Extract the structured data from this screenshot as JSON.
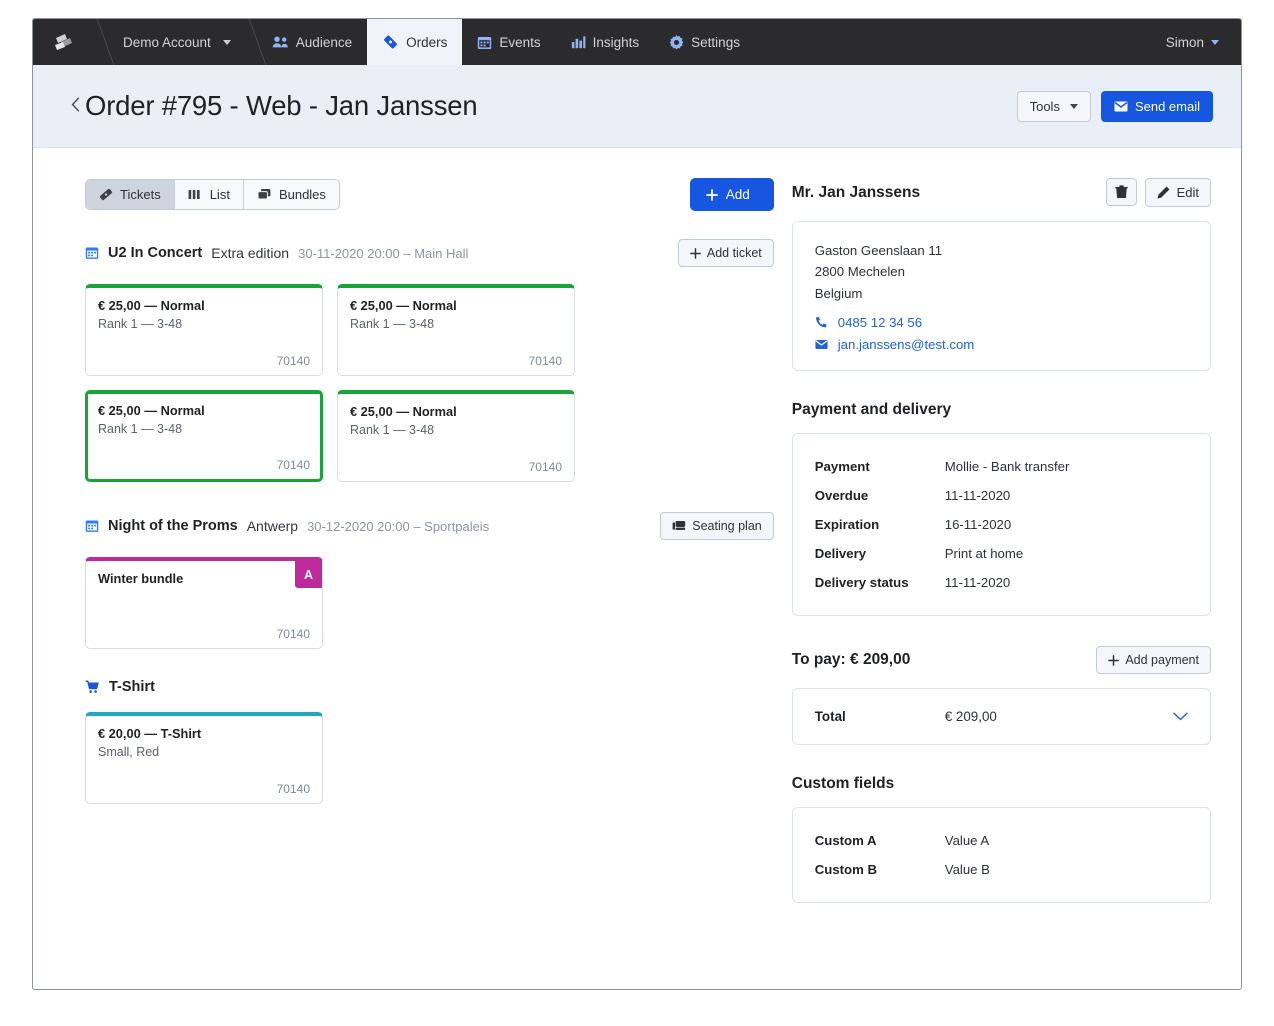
{
  "topnav": {
    "logo_icon": "ticketmatic-logo-icon",
    "account": {
      "label": "Demo Account",
      "icon": "caret-down-icon"
    },
    "items": [
      {
        "label": "Audience",
        "icon": "audience-people-icon",
        "active": false
      },
      {
        "label": "Orders",
        "icon": "ticket-diamond-icon",
        "active": true
      },
      {
        "label": "Events",
        "icon": "calendar-icon",
        "active": false
      },
      {
        "label": "Insights",
        "icon": "bar-chart-icon",
        "active": false
      },
      {
        "label": "Settings",
        "icon": "gear-icon",
        "active": false
      }
    ],
    "user": {
      "label": "Simon",
      "icon": "caret-down-icon"
    }
  },
  "header": {
    "back_icon": "chevron-left-icon",
    "title": "Order #795 - Web - Jan Janssen",
    "tools_label": "Tools",
    "send_email_label": "Send email",
    "send_email_icon": "envelope-icon"
  },
  "toolbar": {
    "tabs": [
      {
        "label": "Tickets",
        "icon": "ticket-icon",
        "active": true
      },
      {
        "label": "List",
        "icon": "list-bars-icon",
        "active": false
      },
      {
        "label": "Bundles",
        "icon": "bundles-stack-icon",
        "active": false
      }
    ],
    "add_label": "Add",
    "add_icon": "plus-icon",
    "add_caret": "caret-down-icon"
  },
  "groups": [
    {
      "icon": "calendar-icon",
      "title": "U2 In Concert",
      "subtitle": "Extra edition",
      "meta": "30-11-2020 20:00 – Main Hall",
      "action": {
        "label": "Add ticket",
        "icon": "plus-icon"
      },
      "cards": [
        {
          "title": "€ 25,00 — Normal",
          "sub": "Rank 1 — 3-48",
          "code": "70140",
          "accent": "#18a538",
          "selected": false
        },
        {
          "title": "€ 25,00 — Normal",
          "sub": "Rank 1 — 3-48",
          "code": "70140",
          "accent": "#18a538",
          "selected": false
        },
        {
          "title": "€ 25,00 — Normal",
          "sub": "Rank 1 — 3-48",
          "code": "70140",
          "accent": "#18a538",
          "selected": true
        },
        {
          "title": "€ 25,00 — Normal",
          "sub": "Rank 1 — 3-48",
          "code": "70140",
          "accent": "#18a538",
          "selected": false
        }
      ]
    },
    {
      "icon": "calendar-icon",
      "title": "Night of the Proms",
      "subtitle": "Antwerp",
      "meta": "30-12-2020 20:00 – Sportpaleis",
      "action": {
        "label": "Seating plan",
        "icon": "seat-icon"
      },
      "cards": [
        {
          "title": "Winter bundle",
          "sub": "",
          "code": "70140",
          "accent": "#bd2a9b",
          "selected": false,
          "badge": "A"
        }
      ]
    },
    {
      "icon": "shopping-cart-icon",
      "title": "T-Shirt",
      "subtitle": "",
      "meta": "",
      "action": null,
      "cards": [
        {
          "title": "€ 20,00 — T-Shirt",
          "sub": "Small, Red",
          "code": "70140",
          "accent": "#24a8c0",
          "selected": false
        }
      ]
    }
  ],
  "customer": {
    "name": "Mr. Jan Janssens",
    "delete_icon": "trash-icon",
    "edit_label": "Edit",
    "edit_icon": "pencil-icon",
    "address": [
      "Gaston Geenslaan 11",
      "2800 Mechelen",
      "Belgium"
    ],
    "phone": {
      "value": "0485 12 34 56",
      "icon": "phone-icon"
    },
    "email": {
      "value": "jan.janssens@test.com",
      "icon": "envelope-icon"
    }
  },
  "payment_section": {
    "title": "Payment and delivery",
    "rows": [
      {
        "label": "Payment",
        "value": "Mollie - Bank transfer"
      },
      {
        "label": "Overdue",
        "value": "11-11-2020"
      },
      {
        "label": "Expiration",
        "value": "16-11-2020"
      },
      {
        "label": "Delivery",
        "value": "Print at home"
      },
      {
        "label": "Delivery status",
        "value": "11-11-2020"
      }
    ]
  },
  "topay_section": {
    "title": "To pay: € 209,00",
    "add_payment_label": "Add payment",
    "add_payment_icon": "plus-icon",
    "total_label": "Total",
    "total_value": "€ 209,00",
    "expand_icon": "chevron-down-icon"
  },
  "custom_fields": {
    "title": "Custom fields",
    "rows": [
      {
        "label": "Custom A",
        "value": "Value A"
      },
      {
        "label": "Custom B",
        "value": "Value B"
      }
    ]
  },
  "colors": {
    "nav_bg": "#2b2b2d",
    "header_bg": "#eaeff7",
    "primary": "#1756e0",
    "green": "#18a538",
    "magenta": "#bd2a9b",
    "teal": "#24a8c0",
    "link": "#1d62e8"
  }
}
